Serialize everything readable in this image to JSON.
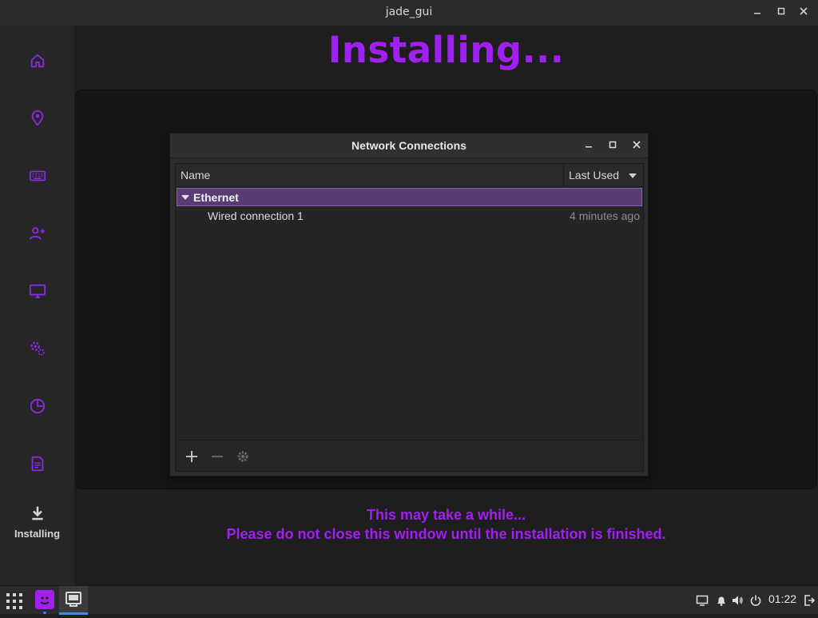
{
  "window": {
    "title": "jade_gui",
    "controls": {
      "minimize": "–",
      "maximize": "□",
      "close": "✕"
    }
  },
  "sidebar": {
    "items": [
      {
        "icon": "home-icon"
      },
      {
        "icon": "location-pin-icon"
      },
      {
        "icon": "keyboard-icon"
      },
      {
        "icon": "add-user-icon"
      },
      {
        "icon": "monitor-icon"
      },
      {
        "icon": "settings-gears-icon"
      },
      {
        "icon": "partition-pie-icon"
      },
      {
        "icon": "summary-document-icon"
      }
    ],
    "active": {
      "icon": "download-icon",
      "label": "Installing"
    }
  },
  "main": {
    "heading": "Installing...",
    "message_line1": "This may take a while...",
    "message_line2": "Please do not close this window until the installation is finished."
  },
  "dialog": {
    "title": "Network Connections",
    "columns": {
      "name": "Name",
      "last_used": "Last Used"
    },
    "group": "Ethernet",
    "connections": [
      {
        "name": "Wired connection 1",
        "last_used": "4 minutes ago"
      }
    ],
    "footer_buttons": [
      "add-icon",
      "remove-icon",
      "settings-gear-icon"
    ]
  },
  "taskbar": {
    "clock": "01:22",
    "tray_icons": [
      "screen-icon",
      "bell-icon",
      "volume-icon",
      "power-icon",
      "logout-icon"
    ]
  },
  "colors": {
    "accent": "#a020f0",
    "selection": "#5a3b73",
    "active_indicator": "#3a8ee6"
  }
}
